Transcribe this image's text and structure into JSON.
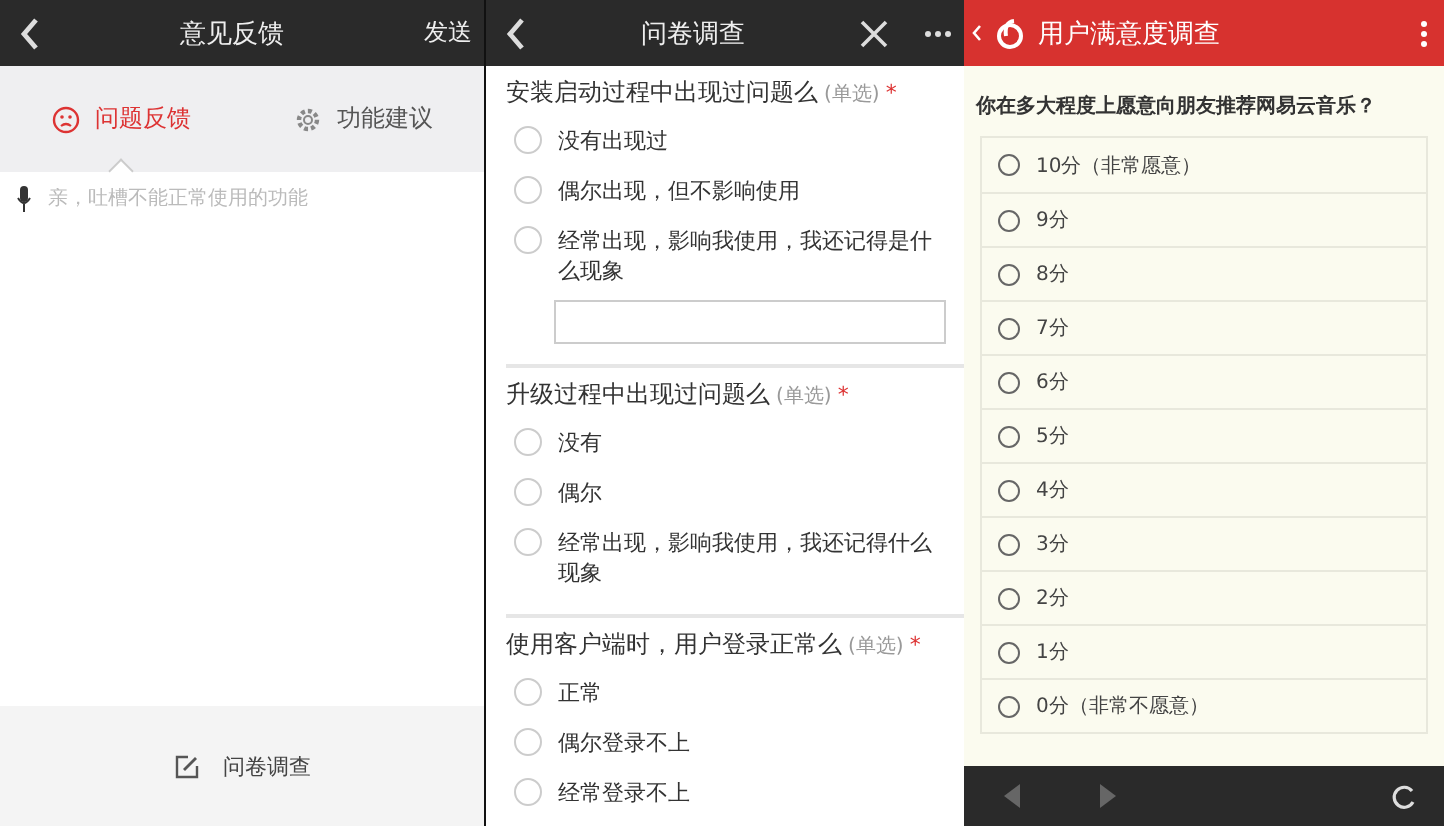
{
  "feedback_screen": {
    "header": {
      "title": "意见反馈",
      "action": "发送"
    },
    "tabs": [
      {
        "label": "问题反馈",
        "kind": "problem",
        "selected": true
      },
      {
        "label": "功能建议",
        "kind": "suggestion",
        "selected": false
      }
    ],
    "input": {
      "placeholder": "亲，吐槽不能正常使用的功能"
    },
    "bottom_link": "问卷调查"
  },
  "survey_screen": {
    "header": {
      "title": "问卷调查"
    },
    "questions": [
      {
        "title": "安装启动过程中出现过问题么",
        "type_note": "(单选)",
        "required_mark": "*",
        "has_text_field": true,
        "options": [
          {
            "label": "没有出现过",
            "selected": false
          },
          {
            "label": "偶尔出现，但不影响使用",
            "selected": false
          },
          {
            "label": "经常出现，影响我使用，我还记得是什么现象",
            "selected": false
          }
        ]
      },
      {
        "title": "升级过程中出现过问题么",
        "type_note": "(单选)",
        "required_mark": "*",
        "has_text_field": false,
        "options": [
          {
            "label": "没有",
            "selected": false
          },
          {
            "label": "偶尔",
            "selected": false
          },
          {
            "label": "经常出现，影响我使用，我还记得什么现象",
            "selected": false
          }
        ]
      },
      {
        "title": "使用客户端时，用户登录正常么",
        "type_note": "(单选)",
        "required_mark": "*",
        "has_text_field": false,
        "options": [
          {
            "label": "正常",
            "selected": false
          },
          {
            "label": "偶尔登录不上",
            "selected": false
          },
          {
            "label": "经常登录不上",
            "selected": false
          }
        ]
      }
    ]
  },
  "satisfaction_screen": {
    "header": {
      "title": "用户满意度调查"
    },
    "question": "你在多大程度上愿意向朋友推荐网易云音乐？",
    "options": [
      {
        "label": "10分（非常愿意）",
        "selected": false
      },
      {
        "label": "9分",
        "selected": false
      },
      {
        "label": "8分",
        "selected": false
      },
      {
        "label": "7分",
        "selected": false
      },
      {
        "label": "6分",
        "selected": false
      },
      {
        "label": "5分",
        "selected": false
      },
      {
        "label": "4分",
        "selected": false
      },
      {
        "label": "3分",
        "selected": false
      },
      {
        "label": "2分",
        "selected": false
      },
      {
        "label": "1分",
        "selected": false
      },
      {
        "label": "0分（非常不愿意）",
        "selected": false
      }
    ]
  }
}
